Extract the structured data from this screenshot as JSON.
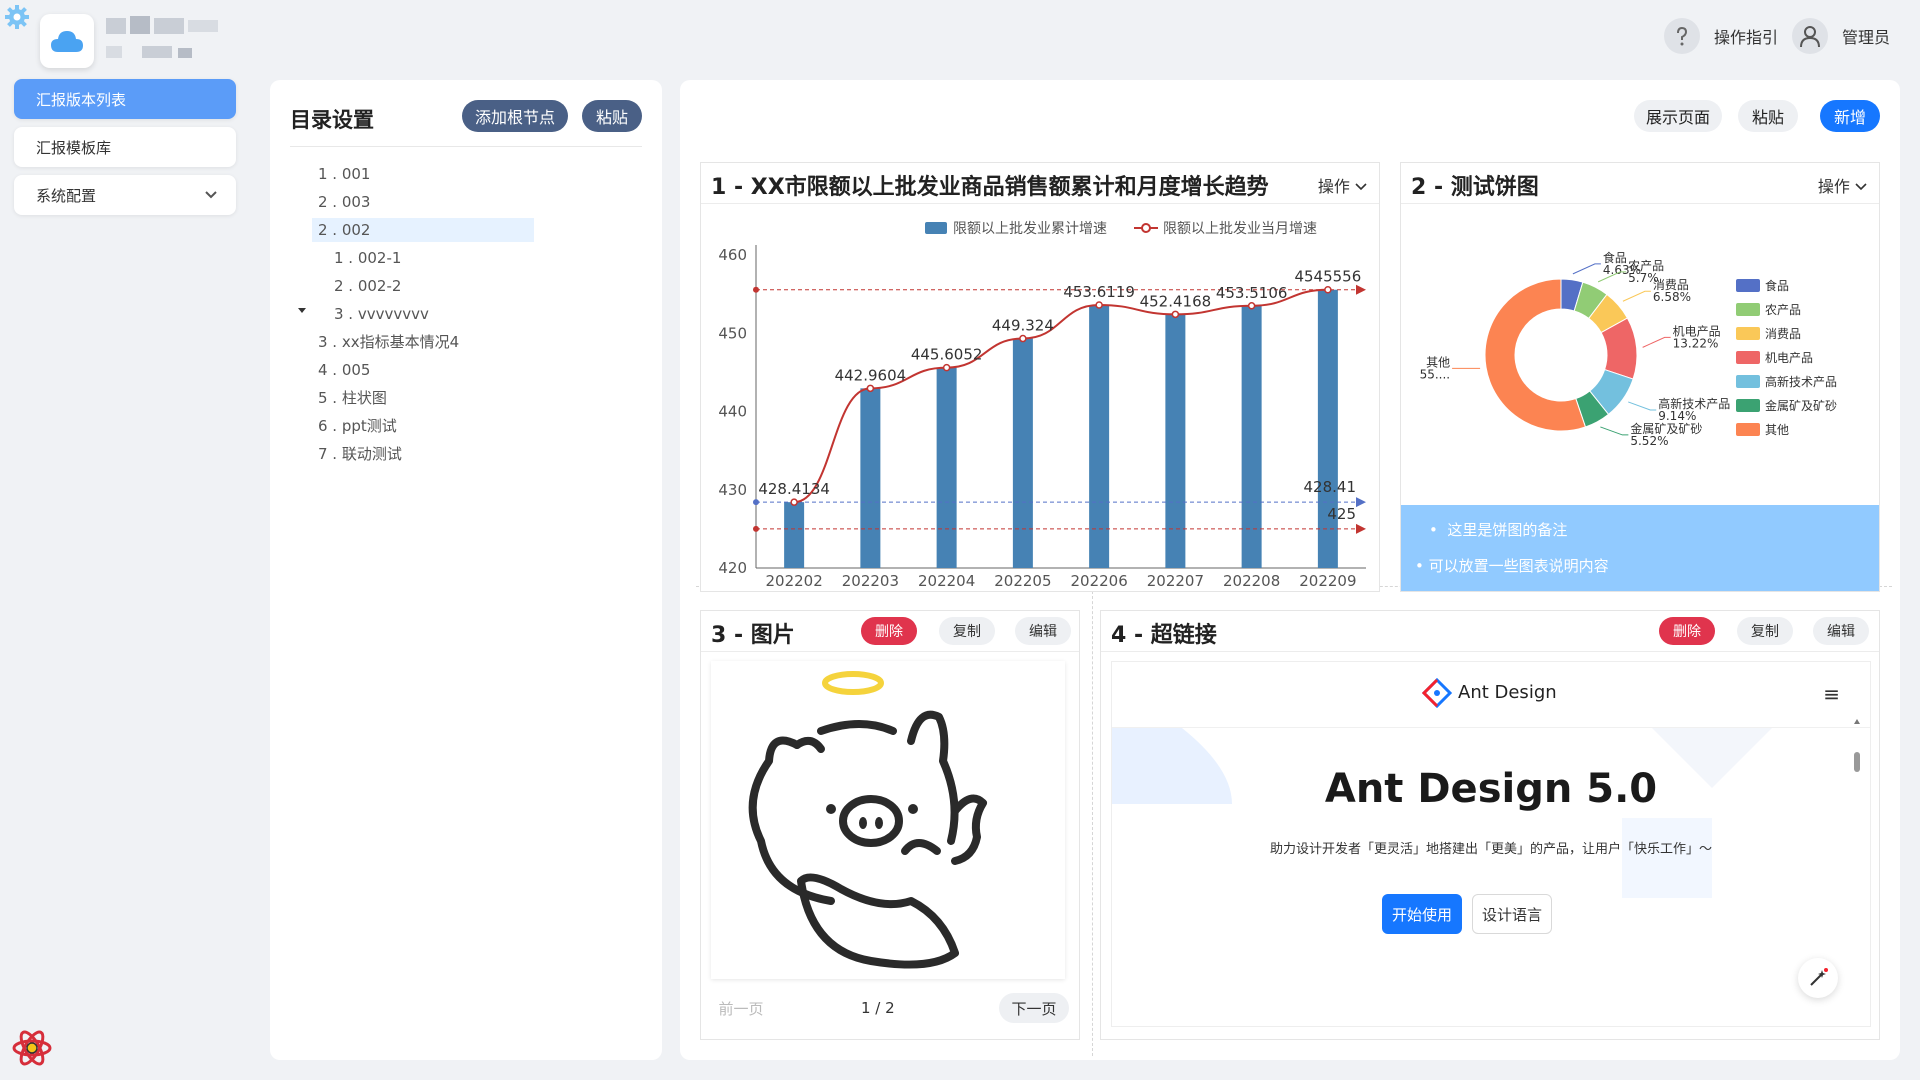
{
  "header": {
    "guide_label": "操作指引",
    "user_label": "管理员"
  },
  "sidebar": {
    "items": [
      {
        "label": "汇报版本列表"
      },
      {
        "label": "汇报模板库"
      },
      {
        "label": "系统配置"
      }
    ]
  },
  "directory": {
    "title": "目录设置",
    "add_root_label": "添加根节点",
    "paste_label": "粘贴",
    "tree": [
      {
        "label": "1 . 001"
      },
      {
        "label": "2 . 003"
      },
      {
        "label": "2 . 002"
      },
      {
        "label": "1 . 002-1"
      },
      {
        "label": "2 . 002-2"
      },
      {
        "label": "3 . vvvvvvvv"
      },
      {
        "label": "3 . xx指标基本情况4"
      },
      {
        "label": "4 . 005"
      },
      {
        "label": "5 . 柱状图"
      },
      {
        "label": "6 . ppt测试"
      },
      {
        "label": "7 . 联动测试"
      }
    ]
  },
  "toolbar": {
    "show_page_label": "展示页面",
    "paste_label": "粘贴",
    "add_label": "新增"
  },
  "cards": {
    "c1": {
      "title": "1 - XX市限额以上批发业商品销售额累计和月度增长趋势",
      "op_label": "操作"
    },
    "c2": {
      "title": "2 - 测试饼图",
      "op_label": "操作",
      "notes": [
        "这里是饼图的备注",
        "可以放置一些图表说明内容"
      ]
    },
    "c3": {
      "title": "3 - 图片",
      "delete_label": "删除",
      "copy_label": "复制",
      "edit_label": "编辑",
      "prev_label": "前一页",
      "page_info": "1 / 2",
      "next_label": "下一页"
    },
    "c4": {
      "title": "4 - 超链接",
      "delete_label": "删除",
      "copy_label": "复制",
      "edit_label": "编辑",
      "site_name": "Ant Design",
      "hero_title": "Ant Design 5.0",
      "hero_sub": "助力设计开发者「更灵活」地搭建出「更美」的产品，让用户「快乐工作」～",
      "start_label": "开始使用",
      "design_label": "设计语言"
    }
  },
  "chart_data": [
    {
      "type": "bar",
      "categories": [
        "202202",
        "202203",
        "202204",
        "202205",
        "202206",
        "202207",
        "202208",
        "202209"
      ],
      "series": [
        {
          "name": "限额以上批发业累计增速",
          "type": "bar",
          "values": [
            428.4134,
            442.9604,
            445.6052,
            449.324,
            453.6119,
            452.4168,
            453.5106,
            455.56
          ]
        },
        {
          "name": "限额以上批发业当月增速",
          "type": "line",
          "values": [
            428.4134,
            442.9604,
            445.6052,
            449.324,
            453.6119,
            452.4168,
            453.5106,
            455.56
          ]
        }
      ],
      "data_labels": [
        "428.4134",
        "442.9604",
        "445.6052",
        "449.324",
        "453.6119",
        "452.4168",
        "453.5106",
        "4545556"
      ],
      "markline_labels": [
        "428.41",
        "425"
      ],
      "ylim": [
        420,
        460
      ],
      "yticks": [
        420,
        430,
        440,
        450,
        460
      ],
      "colors": {
        "bar": "#4682b4",
        "line": "#c23531"
      }
    },
    {
      "type": "pie",
      "labels": [
        "食品",
        "农产品",
        "消费品",
        "机电产品",
        "高新技术产品",
        "金属矿及矿砂",
        "其他"
      ],
      "values": [
        4.63,
        5.7,
        6.58,
        13.22,
        9.14,
        5.52,
        55.21
      ],
      "slice_labels": [
        "4.63%",
        "5.7%",
        "6.58%",
        "13.22%",
        "9.14%",
        "5.52%",
        "55...."
      ],
      "colors": [
        "#5470c6",
        "#91cc75",
        "#fac858",
        "#ee6666",
        "#73c0de",
        "#3ba272",
        "#fc8452"
      ]
    }
  ]
}
